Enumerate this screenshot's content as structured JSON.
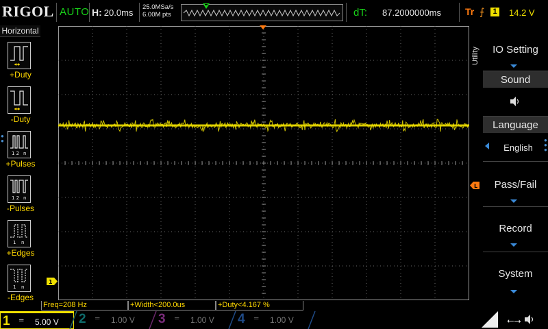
{
  "top": {
    "brand": "RIGOL",
    "run_state": "AUTO",
    "timebase_label": "H:",
    "timebase_value": "20.0ms",
    "sample_rate": "25.0MSa/s",
    "memory_depth": "6.00M pts",
    "dt_label": "dT:",
    "dt_value": "87.2000000ms",
    "trigger_type": "Tr",
    "trigger_source": "1",
    "trigger_level": "14.2 V"
  },
  "left_panel": {
    "title": "Horizontal",
    "items": [
      {
        "label": "+Duty",
        "icon": "positive-duty-icon"
      },
      {
        "label": "-Duty",
        "icon": "negative-duty-icon"
      },
      {
        "label": "+Pulses",
        "icon": "positive-pulses-icon"
      },
      {
        "label": "-Pulses",
        "icon": "negative-pulses-icon"
      },
      {
        "label": "+Edges",
        "icon": "rising-edges-icon"
      },
      {
        "label": "-Edges",
        "icon": "falling-edges-icon"
      }
    ]
  },
  "measurements": [
    {
      "text": "Freq=208 Hz"
    },
    {
      "text": "+Width<200.0us"
    },
    {
      "text": "+Duty<4.167 %"
    }
  ],
  "channels": [
    {
      "num": "1",
      "coupling": "═",
      "scale": "5.00 V",
      "color": "#f0e000"
    },
    {
      "num": "2",
      "coupling": "═",
      "scale": "1.00 V",
      "color": "#0e6b6b"
    },
    {
      "num": "3",
      "coupling": "═",
      "scale": "1.00 V",
      "color": "#7a2c7a"
    },
    {
      "num": "4",
      "coupling": "═",
      "scale": "1.00 V",
      "color": "#1f4a86"
    }
  ],
  "menu": {
    "title": "Utility",
    "items": [
      {
        "label": "IO Setting"
      },
      {
        "label": "Sound",
        "value_icon": "speaker-icon"
      },
      {
        "label": "Language",
        "value": "English"
      },
      {
        "label": "Pass/Fail"
      },
      {
        "label": "Record"
      },
      {
        "label": "System"
      }
    ]
  },
  "markers": {
    "ch1_ground": "1",
    "trigger_level": "L"
  },
  "colors": {
    "ch1": "#f0e000",
    "menu_arrow": "#3a8ad8",
    "trigger": "#ff7a10",
    "accent_green": "#19d419"
  }
}
